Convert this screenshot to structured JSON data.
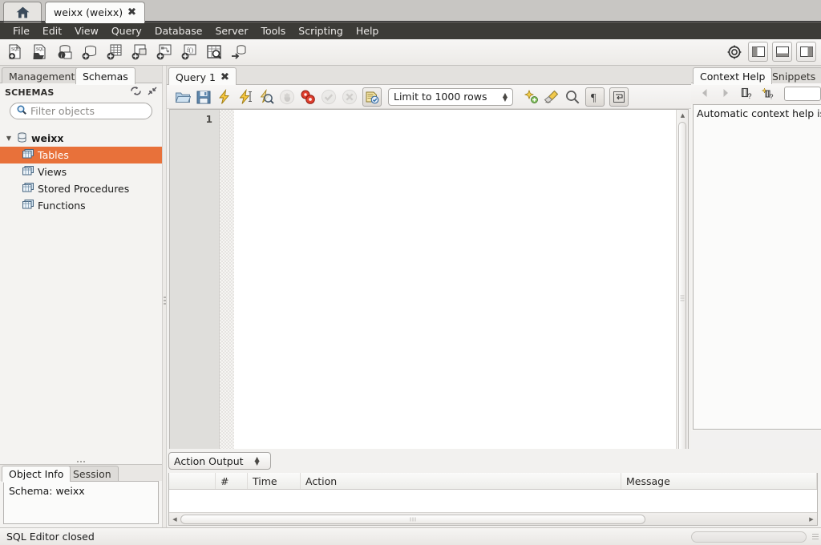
{
  "window": {
    "tabs": [
      {
        "name": "home-tab",
        "icon": "home-icon",
        "label": ""
      },
      {
        "name": "connection-tab",
        "label": "weixx (weixx)",
        "close": "✖",
        "active": true
      }
    ]
  },
  "menubar": {
    "items": [
      "File",
      "Edit",
      "View",
      "Query",
      "Database",
      "Server",
      "Tools",
      "Scripting",
      "Help"
    ]
  },
  "toolbar": {
    "icons": [
      "new-sql-tab-icon",
      "open-sql-script-icon",
      "server-info-icon",
      "new-schema-icon",
      "new-table-icon",
      "new-view-icon",
      "new-procedure-icon",
      "new-function-icon",
      "inspect-table-icon",
      "table-data-export-import-icon"
    ],
    "right_icons": [
      "search-target-icon"
    ],
    "panel_buttons": [
      "toggle-sidebar-icon",
      "toggle-output-icon",
      "toggle-secondary-sidebar-icon"
    ]
  },
  "sidebar": {
    "tabs": [
      {
        "label": "Management",
        "selected": false
      },
      {
        "label": "Schemas",
        "selected": true
      }
    ],
    "header": {
      "label": "SCHEMAS",
      "icons": [
        "refresh-icon",
        "collapse-all-icon"
      ]
    },
    "filter": {
      "placeholder": "Filter objects",
      "value": "",
      "icon": "search-icon"
    },
    "tree": [
      {
        "label": "weixx",
        "level": 0,
        "icon": "schema-icon",
        "twisty": "▼",
        "selected": false,
        "root": true
      },
      {
        "label": "Tables",
        "level": 1,
        "icon": "tables-icon",
        "selected": true
      },
      {
        "label": "Views",
        "level": 1,
        "icon": "views-icon",
        "selected": false
      },
      {
        "label": "Stored Procedures",
        "level": 1,
        "icon": "procedures-icon",
        "selected": false
      },
      {
        "label": "Functions",
        "level": 1,
        "icon": "functions-icon",
        "selected": false
      }
    ],
    "bottom_tabs": [
      {
        "label": "Object Info",
        "selected": true
      },
      {
        "label": "Session",
        "selected": false
      }
    ],
    "object_info": "Schema: weixx"
  },
  "editor": {
    "tab": {
      "label": "Query 1",
      "close": "✖"
    },
    "toolbar": {
      "icons": [
        "open-file-icon",
        "save-file-icon",
        "execute-icon",
        "execute-current-statement-icon",
        "explain-icon",
        "stop-icon",
        "toggle-explain-icon",
        "commit-icon",
        "rollback-icon",
        "toggle-autocommit-icon"
      ],
      "limit_label": "Limit to 1000 rows",
      "right_icons": [
        "beautify-icon",
        "clear-icon",
        "find-icon",
        "invisible-chars-icon",
        "wrap-lines-icon"
      ]
    },
    "line_numbers": [
      "1"
    ],
    "content": ""
  },
  "context_help": {
    "tabs": [
      {
        "label": "Context Help",
        "selected": true
      },
      {
        "label": "Snippets",
        "selected": false
      }
    ],
    "toolbar_icons": [
      "back-icon",
      "forward-icon",
      "manual-help-icon",
      "automatic-help-icon"
    ],
    "body_text": "Automatic context help is"
  },
  "output": {
    "selector": "Action Output",
    "columns": [
      "",
      "#",
      "Time",
      "Action",
      "Message"
    ],
    "rows": []
  },
  "statusbar": {
    "message": "SQL Editor closed"
  },
  "colors": {
    "selection": "#e8713a",
    "menubar_bg": "#3c3b37",
    "panel_bg": "#f4f3f1"
  }
}
